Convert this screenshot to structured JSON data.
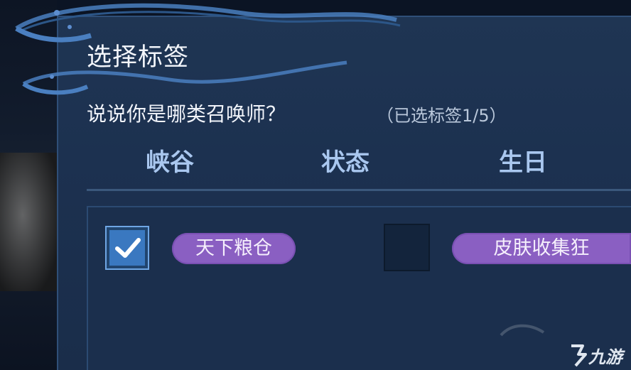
{
  "dialog": {
    "title": "选择标签",
    "question": "说说你是哪类召唤师？",
    "selected_count": "（已选标签1/5）"
  },
  "tabs": [
    {
      "label": "峡谷"
    },
    {
      "label": "状态"
    },
    {
      "label": "生日"
    }
  ],
  "options": [
    {
      "label": "天下粮仓",
      "checked": true
    },
    {
      "label": "皮肤收集狂",
      "checked": false
    }
  ],
  "watermark": {
    "text": "九游"
  },
  "colors": {
    "panel": "#1f3553",
    "tab_text": "#a9c7ef",
    "tag": "#8a5fc2",
    "checkbox_checked": "#3a78c0"
  }
}
